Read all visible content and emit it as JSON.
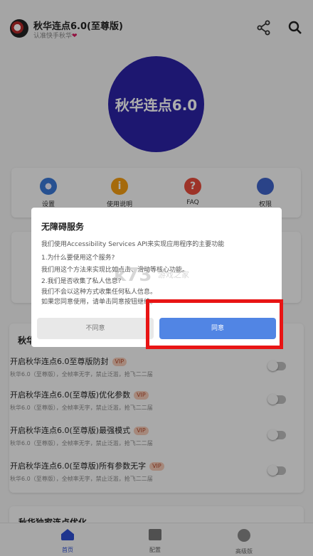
{
  "header": {
    "title": "秋华连点6.0(至尊版)",
    "subtitle": "认准快手秋华",
    "heart": "❤",
    "icons": [
      "share-icon",
      "search-icon"
    ]
  },
  "hero": {
    "text": "秋华连点6.0"
  },
  "quick_actions": [
    {
      "label": "设置",
      "icon": "gear-icon"
    },
    {
      "label": "使用说明",
      "icon": "info-icon"
    },
    {
      "label": "FAQ",
      "icon": "faq-icon"
    },
    {
      "label": "权限",
      "icon": "shield-icon"
    }
  ],
  "features": {
    "heading": "秋华",
    "items": [
      {
        "title": "开启秋华连点6.0至尊版防封",
        "badge": "VIP",
        "desc": "秋华6.0（至尊版），全帧率无字，禁止泛滥，抢飞二二届"
      },
      {
        "title": "开启秋华连点6.0(至尊版)优化参数",
        "badge": "VIP",
        "desc": "秋华6.0（至尊版），全帧率无字，禁止泛滥，抢飞二二届"
      },
      {
        "title": "开启秋华连点6.0(至尊版)最强模式",
        "badge": "VIP",
        "desc": "秋华6.0（至尊版），全帧率无字，禁止泛滥，抢飞二二届"
      },
      {
        "title": "开启秋华连点6.0(至尊版)所有参数无字",
        "badge": "VIP",
        "desc": "秋华6.0（至尊版），全帧率无字，禁止泛滥，抢飞二二届"
      }
    ]
  },
  "card3": {
    "title": "秋华独家连点优化"
  },
  "bottom_nav": [
    {
      "label": "首页",
      "icon": "home-icon"
    },
    {
      "label": "配置",
      "icon": "folder-icon"
    },
    {
      "label": "高级版",
      "icon": "vip-icon"
    }
  ],
  "dialog": {
    "title": "无障碍服务",
    "lines": [
      "我们使用Accessibility Services API来实现应用程序的主要功能",
      "1.为什么要使用这个服务?",
      "我们用这个方法来实现比如点击、滑动等核心功能。",
      "2.我们是否收集了私人信息?",
      "我们不会以这种方式收集任何私人信息。",
      "如果您同意使用，请单击同意按钮继续。"
    ],
    "disagree": "不同意",
    "agree": "同意"
  },
  "watermark": {
    "main": "k73",
    "sub": "游戏之家"
  },
  "colors": {
    "accent": "#5185e4",
    "hero": "#2c23a6",
    "highlight": "#e81414",
    "vip_bg": "#f3c9b6"
  }
}
